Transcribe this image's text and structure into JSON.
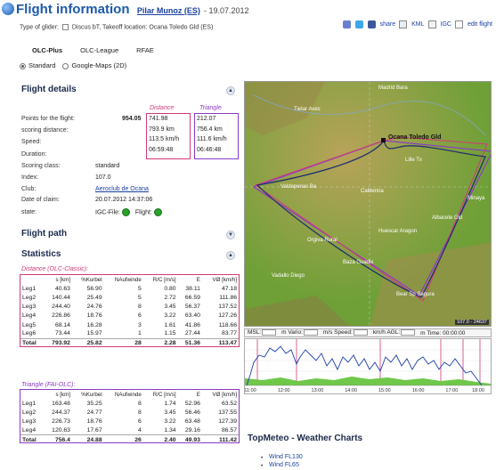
{
  "header": {
    "title": "Flight information",
    "pilot": "Pilar Munoz (ES)",
    "date": "- 19.07.2012",
    "glider_type_label": "Type of glider:",
    "glider": "Discus bT,",
    "takeoff_label": "Takeoff location:",
    "takeoff": "Ocana Toledo Gld (ES)"
  },
  "toolbar": {
    "share": "share",
    "kml": "KML",
    "igc": "IGC",
    "edit_flight": "edit flight"
  },
  "tabs": [
    "OLC-Plus",
    "OLC-League",
    "RFAE"
  ],
  "view": {
    "standard": "Standard",
    "google_maps": "Google-Maps (2D)"
  },
  "flight_details": {
    "heading": "Flight details",
    "col_distance": "Distance",
    "col_triangle": "Triangle",
    "points_label": "Points for the flight:",
    "points_value": "954.05",
    "scoring_distance_label": "scoring distance:",
    "speed_label": "Speed:",
    "duration_label": "Duration:",
    "distance_values": [
      "741.98",
      "793.9 km",
      "113.5 km/h",
      "06:59:48"
    ],
    "triangle_values": [
      "212.07",
      "756.4 km",
      "111.6 km/h",
      "06:46:48"
    ],
    "scoring_class_label": "Scoring class:",
    "scoring_class": "standard",
    "index_label": "Index:",
    "index": "107.0",
    "club_label": "Club:",
    "club": "Aeroclub de Ocana",
    "date_claim_label": "Date of claim:",
    "date_claim": "20.07.2012 14:37:06",
    "state_label": "state:",
    "igc_file_label": "IGC-File:",
    "flight_label": "Flight:"
  },
  "flight_path": {
    "heading": "Flight path"
  },
  "statistics": {
    "heading": "Statistics",
    "distance_caption": "Distance (OLC-Classic):",
    "triangle_caption": "Triangle (FAI-OLC):",
    "columns": [
      "",
      "s [km]",
      "%Kurbel",
      "NAufwinde",
      "R/C [m/s]",
      "E",
      "VØ [km/h]"
    ],
    "distance_rows": [
      [
        "Leg1",
        "40.63",
        "56.90",
        "5",
        "0.80",
        "38.11",
        "47.18"
      ],
      [
        "Leg2",
        "140.44",
        "25.49",
        "5",
        "2.72",
        "66.59",
        "111.86"
      ],
      [
        "Leg3",
        "244.40",
        "24.76",
        "8",
        "3.45",
        "56.37",
        "137.52"
      ],
      [
        "Leg4",
        "226.86",
        "18.76",
        "6",
        "3.22",
        "63.40",
        "127.26"
      ],
      [
        "Leg5",
        "68.14",
        "16.28",
        "3",
        "1.61",
        "41.86",
        "118.66"
      ],
      [
        "Leg6",
        "73.44",
        "15.97",
        "1",
        "1.15",
        "27.44",
        "83.77"
      ]
    ],
    "distance_total": [
      "Total",
      "793.92",
      "25.82",
      "28",
      "2.28",
      "51.36",
      "113.47"
    ],
    "triangle_rows": [
      [
        "Leg1",
        "163.48",
        "35.25",
        "8",
        "1.74",
        "52.96",
        "63.52"
      ],
      [
        "Leg2",
        "244.37",
        "24.77",
        "8",
        "3.45",
        "56.46",
        "137.55"
      ],
      [
        "Leg3",
        "226.73",
        "18.76",
        "6",
        "3.22",
        "63.48",
        "127.39"
      ],
      [
        "Leg4",
        "120.63",
        "17.67",
        "4",
        "1.34",
        "29.16",
        "86.57"
      ]
    ],
    "triangle_total": [
      "Total",
      "756.4",
      "24.88",
      "26",
      "2.40",
      "49.93",
      "111.42"
    ]
  },
  "map": {
    "places": [
      "Madrid Bara",
      "Tietar Aves",
      "Ocana Toledo Gld",
      "Lille Tx",
      "Valdepenas Ba",
      "Calderina",
      "Minaya",
      "Albacete Gld",
      "Huescar Aragon",
      "Orgiva Rural",
      "Baza Guadix",
      "Vadallo Diego",
      "Bear Sp Segura"
    ],
    "scale": "107.0 - 24637"
  },
  "barogram": {
    "msl_label": "MSL:",
    "vario_label": "m Vario:",
    "speed_label": "m/s Speed:",
    "agl_label": "km/h AGL:",
    "time_label": "m Time:",
    "time_value": "00:00:00",
    "time_ticks": [
      "11:00",
      "12:00",
      "13:00",
      "14:00",
      "15:00",
      "16:00",
      "17:00",
      "18:00"
    ]
  },
  "topmeteo": {
    "heading": "TopMeteo - Weather Charts",
    "links": [
      "Wind FL130",
      "Wind FL65"
    ]
  },
  "colors": {
    "distance": "#d03a7a",
    "triangle": "#8a3ac8",
    "title": "#1d5aa8",
    "ok": "#26a326"
  }
}
